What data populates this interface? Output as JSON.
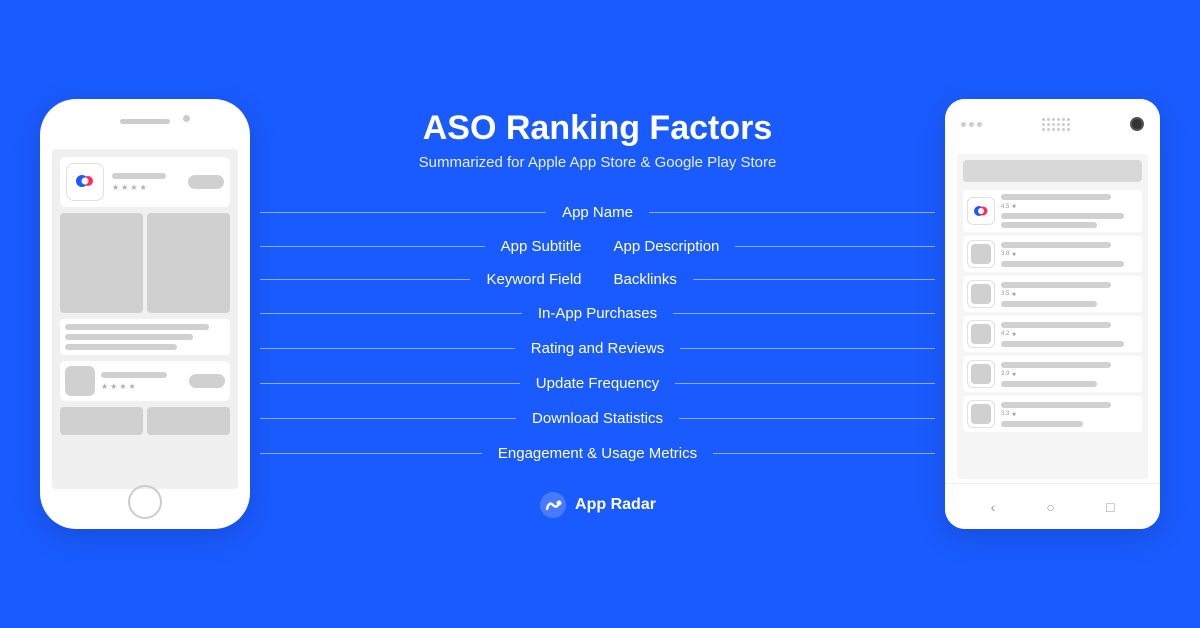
{
  "background_color": "#1a5bff",
  "title": "ASO Ranking Factors",
  "subtitle": "Summarized for Apple App Store & Google Play Store",
  "factors": [
    {
      "label": "App Name",
      "type": "center"
    },
    {
      "label": "App Subtitle",
      "type": "left"
    },
    {
      "label": "App Description",
      "type": "right"
    },
    {
      "label": "Keyword Field",
      "type": "left"
    },
    {
      "label": "Backlinks",
      "type": "right"
    },
    {
      "label": "In-App Purchases",
      "type": "center"
    },
    {
      "label": "Rating and Reviews",
      "type": "center"
    },
    {
      "label": "Update Frequency",
      "type": "center"
    },
    {
      "label": "Download Statistics",
      "type": "center"
    },
    {
      "label": "Engagement & Usage Metrics",
      "type": "center"
    }
  ],
  "brand": {
    "name": "App Radar"
  },
  "android_ratings": [
    "4.5",
    "3.8",
    "3.5",
    "4.2",
    "3.9",
    "3.3"
  ]
}
